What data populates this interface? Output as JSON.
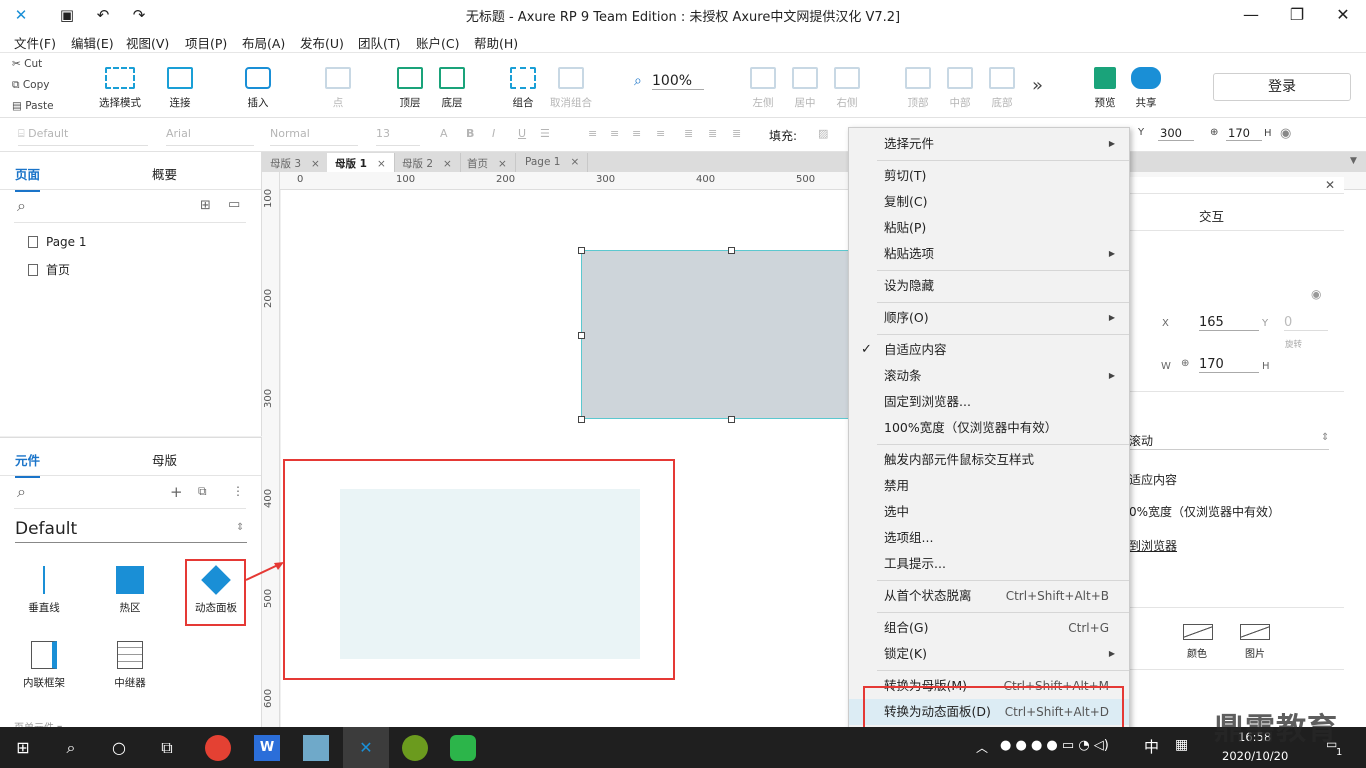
{
  "window": {
    "title": "无标题 - Axure RP 9 Team Edition : 未授权    Axure中文网提供汉化 V7.2]",
    "minimize": "—",
    "maximize": "❐",
    "close": "✕"
  },
  "menu": [
    "文件(F)",
    "编辑(E)",
    "视图(V)",
    "项目(P)",
    "布局(A)",
    "发布(U)",
    "团队(T)",
    "账户(C)",
    "帮助(H)"
  ],
  "clipboard": {
    "cut": "Cut",
    "copy": "Copy",
    "paste": "Paste"
  },
  "toolbar": {
    "select_mode": "选择模式",
    "connect": "连接",
    "insert": "插入",
    "point": "点",
    "top": "顶层",
    "bottom": "底层",
    "group": "组合",
    "ungroup": "取消组合",
    "zoom": "100%",
    "left": "左侧",
    "center": "居中",
    "right": "右侧",
    "top_align": "顶部",
    "middle": "中部",
    "bottom_align": "底部",
    "more": "»",
    "preview": "预览",
    "share": "共享",
    "login": "登录"
  },
  "format": {
    "style": "Default",
    "font": "Arial",
    "weight": "Normal",
    "size": "13",
    "fill_label": "填充:",
    "y_label": "Y",
    "y_value": "300",
    "h_value": "170",
    "h_label": "H"
  },
  "left_top": {
    "tab_pages": "页面",
    "tab_outline": "概要",
    "pages": [
      "Page 1",
      "首页"
    ]
  },
  "left_bottom": {
    "tab_widgets": "元件",
    "tab_masters": "母版",
    "library": "Default",
    "widgets": [
      "垂直线",
      "热区",
      "动态面板",
      "内联框架",
      "中继器"
    ],
    "footer": "页单元件 ▾"
  },
  "doc_tabs": [
    "母版 3",
    "母版 1",
    "母版 2",
    "首页",
    "Page 1"
  ],
  "ruler_top": [
    "0",
    "100",
    "200",
    "300",
    "400",
    "500"
  ],
  "ruler_left": [
    "100",
    "200",
    "300",
    "400",
    "500",
    "600"
  ],
  "right_panel": {
    "tab_interaction": "交互",
    "x_label": "X",
    "x_value": "165",
    "y_label": "Y",
    "y_value": "0",
    "rotate": "旋转",
    "w_label": "W",
    "h_value": "170",
    "h_label": "H",
    "scroll": "滚动",
    "fit": "适应内容",
    "width100": "0%宽度（仅浏览器中有效）",
    "pin": "到浏览器",
    "color": "颜色",
    "image": "图片"
  },
  "context_menu": [
    {
      "label": "选择元件",
      "arrow": "▶"
    },
    {
      "label": "剪切(T)"
    },
    {
      "label": "复制(C)"
    },
    {
      "label": "粘贴(P)"
    },
    {
      "label": "粘贴选项",
      "arrow": "▶"
    },
    {
      "label": "设为隐藏"
    },
    {
      "label": "顺序(O)",
      "arrow": "▶"
    },
    {
      "label": "自适应内容",
      "check": "✓"
    },
    {
      "label": "滚动条",
      "arrow": "▶"
    },
    {
      "label": "固定到浏览器..."
    },
    {
      "label": "100%宽度（仅浏览器中有效）"
    },
    {
      "label": "触发内部元件鼠标交互样式"
    },
    {
      "label": "禁用"
    },
    {
      "label": "选中"
    },
    {
      "label": "选项组..."
    },
    {
      "label": "工具提示..."
    },
    {
      "label": "从首个状态脱离",
      "shortcut": "Ctrl+Shift+Alt+B"
    },
    {
      "label": "组合(G)",
      "shortcut": "Ctrl+G"
    },
    {
      "label": "锁定(K)",
      "arrow": "▶"
    },
    {
      "label": "转换为母版(M)",
      "shortcut": "Ctrl+Shift+Alt+M"
    },
    {
      "label": "转换为动态面板(D)",
      "shortcut": "Ctrl+Shift+Alt+D"
    }
  ],
  "taskbar": {
    "ime": "中",
    "time": "16:58",
    "date": "2020/10/20",
    "notif": "1"
  },
  "watermark": "鼎需教育"
}
